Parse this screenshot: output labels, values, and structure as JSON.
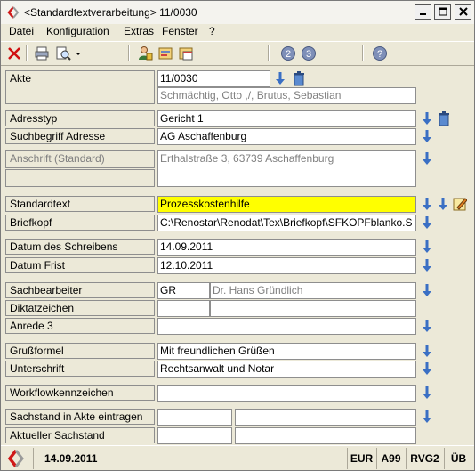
{
  "window": {
    "title": "<Standardtextverarbeitung> 11/0030"
  },
  "menu": [
    "Datei",
    "Konfiguration",
    "Extras",
    "Fenster",
    "?"
  ],
  "toolbar": {
    "circle_2": "2",
    "circle_3": "3"
  },
  "form": {
    "akte": {
      "label": "Akte",
      "value": "11/0030",
      "parties": "Schmächtig, Otto ,/, Brutus, Sebastian"
    },
    "adresstyp": {
      "label": "Adresstyp",
      "value": "Gericht 1"
    },
    "suchbegriff": {
      "label": "Suchbegriff Adresse",
      "value": "AG Aschaffenburg"
    },
    "anschrift": {
      "label": "Anschrift (Standard)",
      "value": "Erthalstraße 3, 63739 Aschaffenburg"
    },
    "standardtext": {
      "label": "Standardtext",
      "value": "Prozesskostenhilfe"
    },
    "briefkopf": {
      "label": "Briefkopf",
      "value": "C:\\Renostar\\Renodat\\Tex\\Briefkopf\\SFKOPFblanko.S"
    },
    "datum_schreiben": {
      "label": "Datum des Schreibens",
      "value": "14.09.2011"
    },
    "datum_frist": {
      "label": "Datum Frist",
      "value": "12.10.2011"
    },
    "sachbearbeiter": {
      "label": "Sachbearbeiter",
      "code": "GR",
      "name": "Dr. Hans Gründlich"
    },
    "diktatzeichen": {
      "label": "Diktatzeichen",
      "value": ""
    },
    "anrede": {
      "label": "Anrede 3",
      "value": ""
    },
    "grussformel": {
      "label": "Grußformel",
      "value": "Mit freundlichen Grüßen"
    },
    "unterschrift": {
      "label": "Unterschrift",
      "value": "Rechtsanwalt und Notar"
    },
    "workflow": {
      "label": "Workflowkennzeichen",
      "value": ""
    },
    "sachstand_eintragen": {
      "label": "Sachstand in Akte eintragen",
      "value": ""
    },
    "aktueller_sachstand": {
      "label": "Aktueller Sachstand",
      "value": ""
    }
  },
  "status": {
    "date": "14.09.2011",
    "currency": "EUR",
    "a": "A99",
    "rvg": "RVG2",
    "ub": "ÜB"
  },
  "colors": {
    "highlight": "#ffff00",
    "dropdown_blue": "#3a6fc4"
  }
}
